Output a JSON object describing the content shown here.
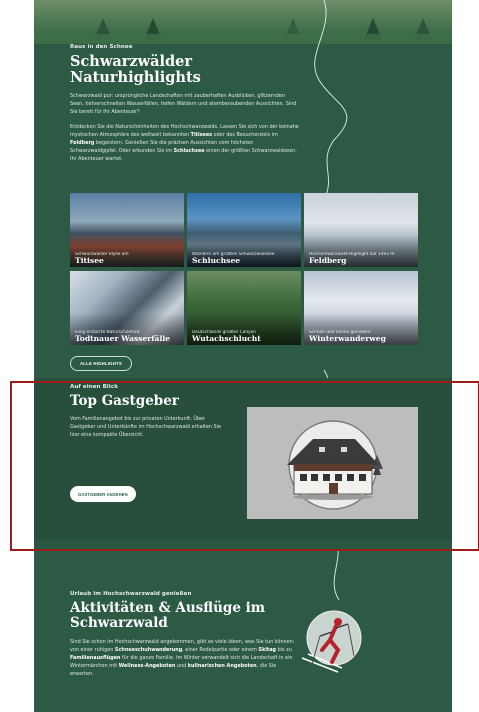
{
  "hero": {
    "eyebrow": "Raus in den Schnee",
    "title_line1": "Schwarzwälder",
    "title_line2": "Naturhighlights",
    "para1": "Schwarzwald pur: ursprüngliche Landschaften mit zauberhaften Ausblicken, glitzernden Seen, tiefverschneiten Wasserfällen, tiefen Wäldern und atemberaubenden Aussichten. Sind Sie bereit für Ihr Abenteuer?",
    "para2_a": "Entdecken Sie die Naturschönheiten des Hochschwarzwalds. Lassen Sie sich von der beinahe mystischen Atmosphäre des weltweit bekannten ",
    "para2_b": "Titisees",
    "para2_c": " oder des Besucherziels im ",
    "para2_d": "Feldberg",
    "para2_e": " begeistern. Genießen Sie die präzisen Aussichten vom höchsten Schwarzwaldgipfel. Oder erkunden Sie im ",
    "para2_f": "Schluchsee",
    "para2_g": " einen der größten Schwarzwaldseen, Ihr Abenteuer wartet."
  },
  "tiles": [
    {
      "caption": "Schwarzwälder Idylle am",
      "name": "Titisee"
    },
    {
      "caption": "Wandern am größten Schwarzwaldsee",
      "name": "Schluchsee"
    },
    {
      "caption": "Hochschwarzwald-Highlight auf 1493 m",
      "name": "Feldberg"
    },
    {
      "caption": "Eisig erstarrte Naturschönheit",
      "name": "Todtnauer Wasserfälle"
    },
    {
      "caption": "Deutschlands größter Canyon",
      "name": "Wutachschlucht"
    },
    {
      "caption": "Schnee und Sonne genießen",
      "name": "Winterwanderweg"
    }
  ],
  "highlights_button": "ALLE HIGHLIGHTS",
  "gastgeber": {
    "eyebrow": "Auf einen Blick",
    "title": "Top Gastgeber",
    "para": "Vom Familienangebot bis zur privaten Unterkunft: Über Gastgeber und Unterkünfte im Hochschwarzwald erhalten Sie hier eine kompakte Übersicht.",
    "button": "GASTGEBER ANSEHEN"
  },
  "aktivitaeten": {
    "eyebrow": "Urlaub im Hochschwarzwald genießen",
    "title_line1": "Aktivitäten & Ausflüge im",
    "title_line2": "Schwarzwald",
    "para_a": "Sind Sie schon im Hochschwarzwald angekommen, gibt es viele Ideen, was Sie tun können: von einer ruhigen ",
    "para_b": "Schneeschuhwanderung",
    "para_c": ", einer Rodelpartie oder einem ",
    "para_d": "Skitag",
    "para_e": " bis zu ",
    "para_f": "Familienausflügen",
    "para_g": " für die ganze Familie. Im Winter verwandelt sich die Landschaft in ein Wintermärchen mit ",
    "para_h": "Wellness-Angeboten",
    "para_i": " und ",
    "para_j": "kulinarischen Angeboten",
    "para_k": ", die Sie erwarten."
  },
  "colors": {
    "page_green": "#2d5a44",
    "section_green": "#274f3c",
    "frame_red": "#9c1c1c"
  }
}
